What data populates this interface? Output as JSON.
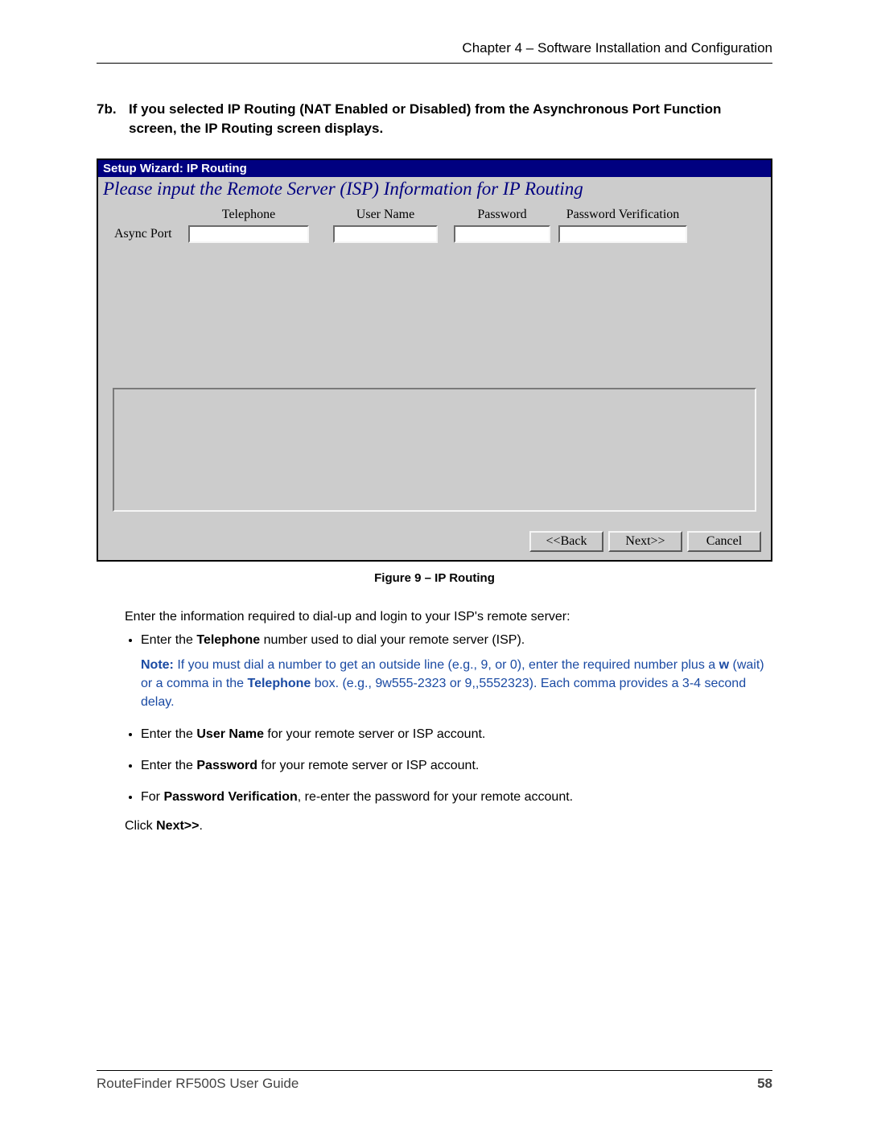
{
  "header": {
    "chapter": "Chapter 4 – Software Installation and Configuration"
  },
  "step": {
    "number": "7b.",
    "text": "If you selected IP Routing (NAT Enabled or Disabled) from the Asynchronous Port Function screen, the IP Routing screen displays."
  },
  "wizard": {
    "title": "Setup Wizard: IP Routing",
    "subtitle": "Please input the Remote Server (ISP) Information for IP Routing",
    "columns": {
      "telephone": "Telephone",
      "user_name": "User Name",
      "password": "Password",
      "password_verification": "Password Verification"
    },
    "row_label": "Async Port",
    "inputs": {
      "telephone": "",
      "user_name": "",
      "password": "",
      "password_verification": ""
    },
    "buttons": {
      "back": "<<Back",
      "next": "Next>>",
      "cancel": "Cancel"
    }
  },
  "caption": "Figure 9 – IP Routing",
  "intro": "Enter the information required to dial-up and login to your ISP's remote server:",
  "bullets": {
    "b1_pre": "Enter the ",
    "b1_bold": "Telephone",
    "b1_post": " number used to dial your remote server (ISP).",
    "note_label": "Note:",
    "note_pre": " If you must dial a number to get an outside line (e.g., 9, or 0), enter the required number  plus a ",
    "note_w": "w",
    "note_mid": " (wait) or a comma in the ",
    "note_tel": "Telephone",
    "note_post": " box. (e.g., 9w555-2323 or 9,,5552323). Each comma provides a 3-4 second delay.",
    "b2_pre": "Enter the ",
    "b2_bold": "User Name",
    "b2_post": " for your remote server or ISP account.",
    "b3_pre": "Enter the ",
    "b3_bold": "Password",
    "b3_post": " for your remote server or ISP account.",
    "b4_pre": "For ",
    "b4_bold": "Password Verification",
    "b4_post": ", re-enter the password for your remote account."
  },
  "final": {
    "pre": "Click ",
    "bold": "Next>>",
    "post": "."
  },
  "footer": {
    "guide": "RouteFinder RF500S User Guide",
    "page": "58"
  }
}
